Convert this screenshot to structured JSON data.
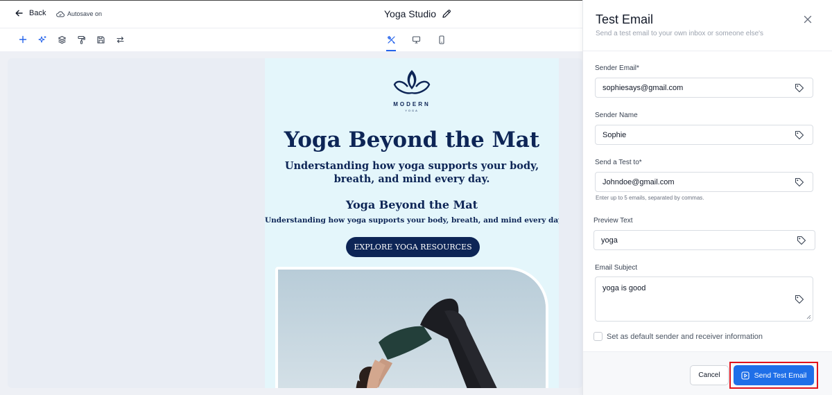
{
  "topbar": {
    "back_label": "Back",
    "autosave_label": "Autosave on",
    "title": "Yoga Studio"
  },
  "toolbar": {
    "left_icons": [
      "plus-icon",
      "sparkle-icon",
      "layers-icon",
      "paint-roller-icon",
      "save-icon",
      "swap-icon"
    ],
    "view_icons": [
      "design-tools-icon",
      "desktop-icon",
      "mobile-icon"
    ],
    "active_view": "design-tools-icon",
    "accent_color": "#2563eb"
  },
  "email": {
    "logo_word": "MODERN",
    "logo_sub": "YOGA",
    "headline": "Yoga Beyond the Mat",
    "subheadline": "Understanding how yoga supports your body, breath, and mind every day.",
    "section_title": "Yoga Beyond the Mat",
    "section_text": "Understanding how yoga supports your body, breath, and mind every day.",
    "cta_label": "EXPLORE YOGA RESOURCES",
    "background_color": "#e4f6fb",
    "brand_color": "#0d2556"
  },
  "panel": {
    "title": "Test Email",
    "subtitle": "Send a test email to your own inbox or someone else's",
    "fields": {
      "sender_email": {
        "label": "Sender Email*",
        "value": "sophiesays@gmail.com"
      },
      "sender_name": {
        "label": "Sender Name",
        "value": "Sophie"
      },
      "send_to": {
        "label": "Send a Test to*",
        "value": "Johndoe@gmail.com",
        "hint": "Enter up to 5 emails, separated by commas."
      },
      "preview_text": {
        "label": "Preview Text",
        "value": "yoga"
      },
      "email_subject": {
        "label": "Email Subject",
        "value": "yoga is good"
      }
    },
    "default_checkbox_label": "Set as default sender and receiver information",
    "default_checked": false,
    "cancel_label": "Cancel",
    "send_label": "Send Test Email",
    "send_color": "#1f6fe8",
    "highlight_color": "#e1121b"
  }
}
